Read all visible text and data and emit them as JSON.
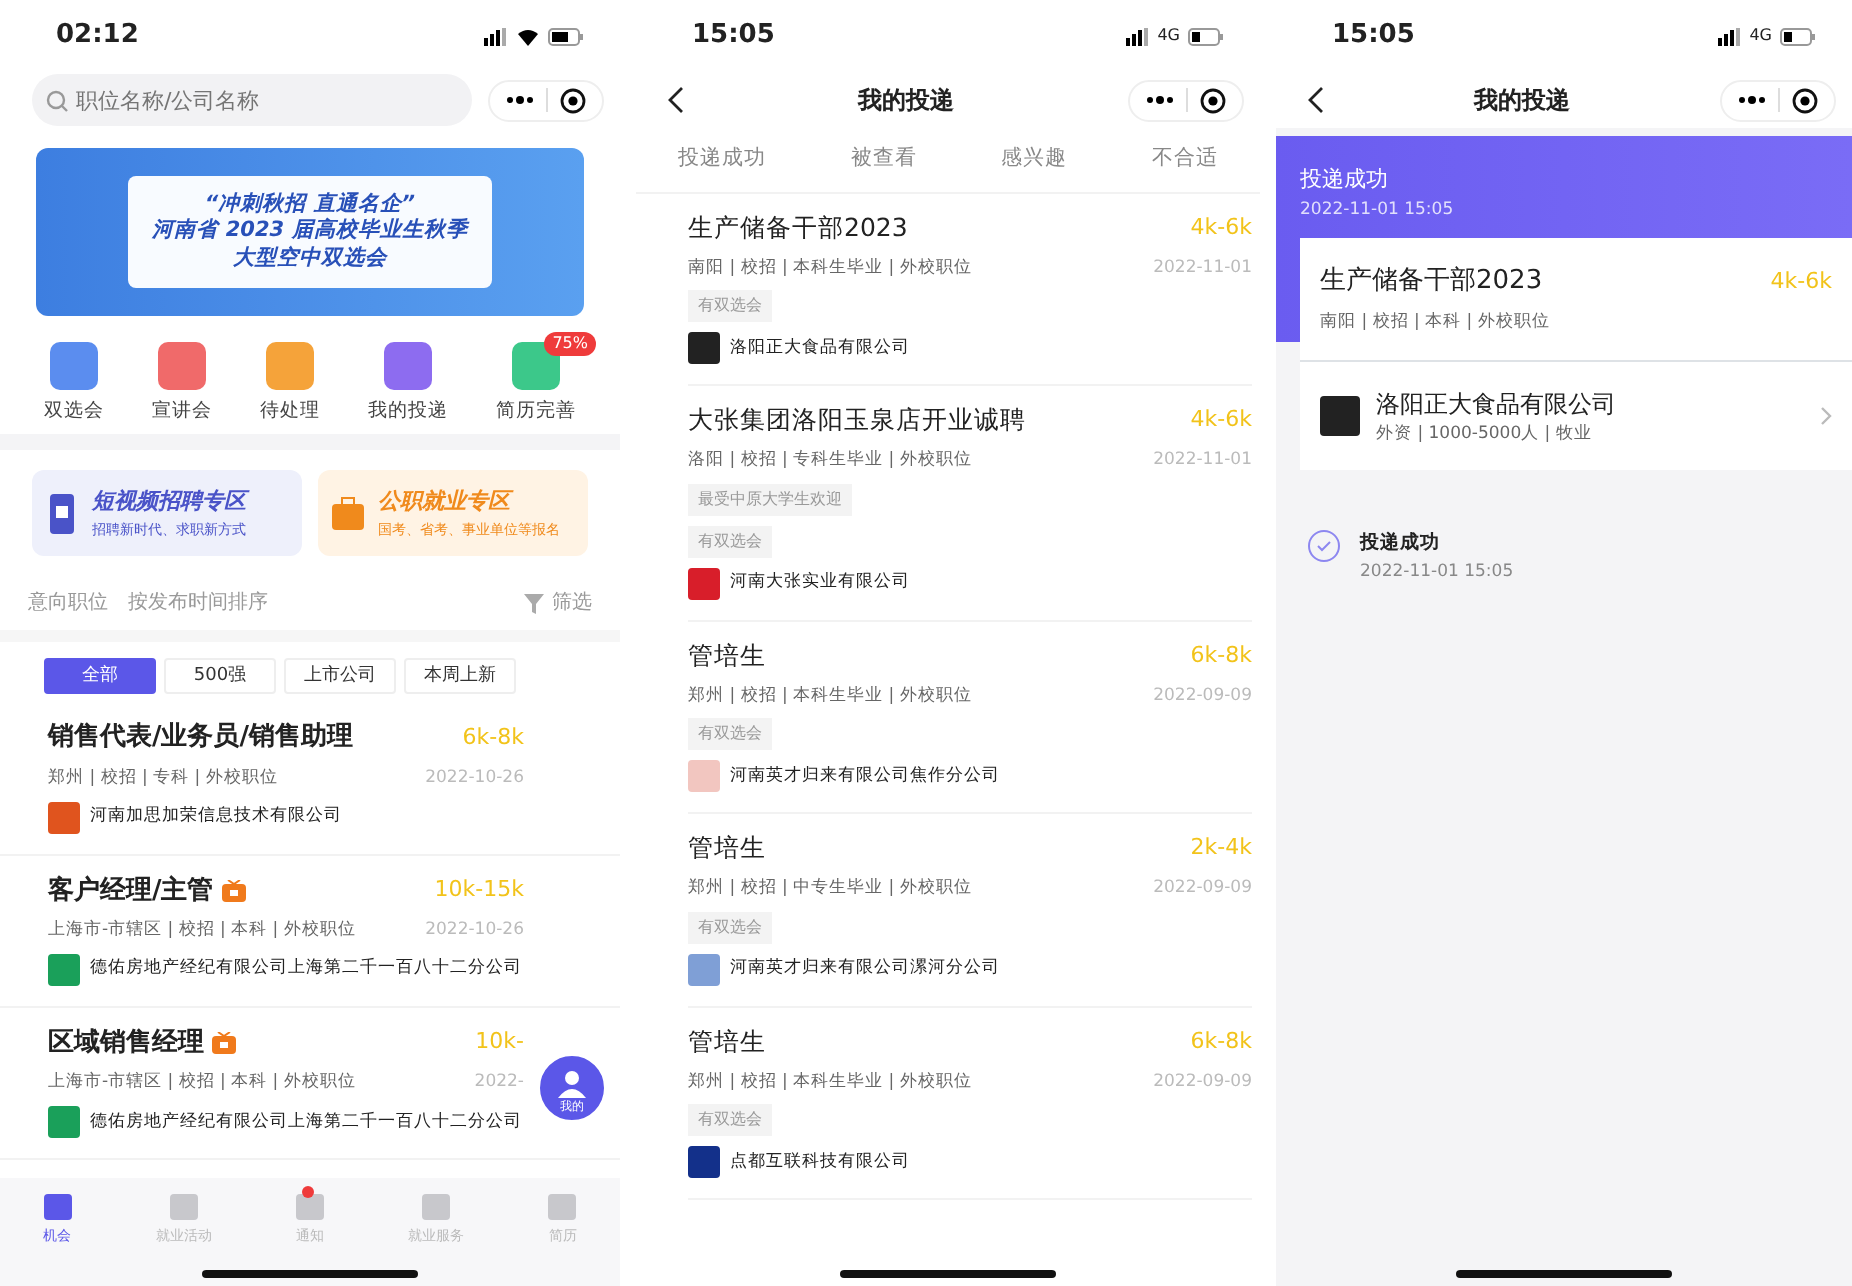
{
  "home": {
    "status_time": "02:12",
    "search": {
      "placeholder": "职位名称/公司名称"
    },
    "banner": {
      "lines": [
        "“冲刺秋招 直通名企”",
        "河南省 2023 届高校毕业生秋季",
        "大型空中双选会"
      ]
    },
    "shortcuts": [
      {
        "label": "双选会",
        "color": "#5b8def"
      },
      {
        "label": "宣讲会",
        "color": "#f06a6a"
      },
      {
        "label": "待处理",
        "color": "#f5a33a"
      },
      {
        "label": "我的投递",
        "color": "#8d6cf0"
      },
      {
        "label": "简历完善",
        "color": "#3cc88a",
        "badge": "75%"
      }
    ],
    "promos": [
      {
        "kind": "video",
        "title": "短视频招聘专区",
        "subtitle": "招聘新时代、求职新方式"
      },
      {
        "kind": "public",
        "title": "公职就业专区",
        "subtitle": "国考、省考、事业单位等报名"
      }
    ],
    "dropdowns": [
      "意向职位",
      "按发布时间排序"
    ],
    "filter_label": "筛选",
    "chips": [
      {
        "label": "全部",
        "selected": true
      },
      {
        "label": "500强",
        "selected": false
      },
      {
        "label": "上市公司",
        "selected": false
      },
      {
        "label": "本周上新",
        "selected": false
      }
    ],
    "jobs": [
      {
        "title": "销售代表/业务员/销售助理",
        "hot": false,
        "salary": "6k-8k",
        "meta": "郑州 | 校招 | 专科 | 外校职位",
        "date": "2022-10-26",
        "company": "河南加思加荣信息技术有限公司",
        "color": "#e0541e"
      },
      {
        "title": "客户经理/主管",
        "hot": true,
        "salary": "10k-15k",
        "meta": "上海市-市辖区 | 校招 | 本科 | 外校职位",
        "date": "2022-10-26",
        "company": "德佑房地产经纪有限公司上海第二千一百八十二分公司",
        "color": "#1aa05a"
      },
      {
        "title": "区域销售经理",
        "hot": true,
        "salary": "10k-",
        "meta": "上海市-市辖区 | 校招 | 本科 | 外校职位",
        "date": "2022-",
        "company": "德佑房地产经纪有限公司上海第二千一百八十二分公司",
        "color": "#1aa05a"
      }
    ],
    "float_button": {
      "label": "我的"
    },
    "tabbar": [
      {
        "label": "机会",
        "selected": true
      },
      {
        "label": "就业活动",
        "selected": false
      },
      {
        "label": "通知",
        "selected": false,
        "dot": true
      },
      {
        "label": "就业服务",
        "selected": false
      },
      {
        "label": "简历",
        "selected": false
      }
    ]
  },
  "applications": {
    "status_time": "15:05",
    "network": "4G",
    "title": "我的投递",
    "tabs": [
      "投递成功",
      "被查看",
      "感兴趣",
      "不合适"
    ],
    "jobs": [
      {
        "title": "生产储备干部2023",
        "salary": "4k-6k",
        "meta": "南阳 | 校招 | 本科生毕业 | 外校职位",
        "date": "2022-11-01",
        "tags": [
          "有双选会"
        ],
        "company": "洛阳正大食品有限公司",
        "color": "#222222"
      },
      {
        "title": "大张集团洛阳玉泉店开业诚聘",
        "salary": "4k-6k",
        "meta": "洛阳 | 校招 | 专科生毕业 | 外校职位",
        "date": "2022-11-01",
        "tags": [
          "最受中原大学生欢迎",
          "有双选会"
        ],
        "company": "河南大张实业有限公司",
        "color": "#d81e2a"
      },
      {
        "title": "管培生",
        "salary": "6k-8k",
        "meta": "郑州 | 校招 | 本科生毕业 | 外校职位",
        "date": "2022-09-09",
        "tags": [
          "有双选会"
        ],
        "company": "河南英才归来有限公司焦作分公司",
        "color": "#f2c6c0"
      },
      {
        "title": "管培生",
        "salary": "2k-4k",
        "meta": "郑州 | 校招 | 中专生毕业 | 外校职位",
        "date": "2022-09-09",
        "tags": [
          "有双选会"
        ],
        "company": "河南英才归来有限公司漯河分公司",
        "color": "#7f9fd6"
      },
      {
        "title": "管培生",
        "salary": "6k-8k",
        "meta": "郑州 | 校招 | 本科生毕业 | 外校职位",
        "date": "2022-09-09",
        "tags": [
          "有双选会"
        ],
        "company": "点都互联科技有限公司",
        "color": "#13308a"
      }
    ]
  },
  "detail": {
    "status_time": "15:05",
    "network": "4G",
    "title": "我的投递",
    "status": "投递成功",
    "status_time_text": "2022-11-01 15:05",
    "job": {
      "title": "生产储备干部2023",
      "salary": "4k-6k",
      "meta": "南阳 | 校招 | 本科 | 外校职位"
    },
    "company": {
      "name": "洛阳正大食品有限公司",
      "meta": "外资 | 1000-5000人 | 牧业",
      "color": "#222222"
    },
    "timeline": [
      {
        "label": "投递成功",
        "time": "2022-11-01 15:05",
        "done": true
      }
    ]
  }
}
